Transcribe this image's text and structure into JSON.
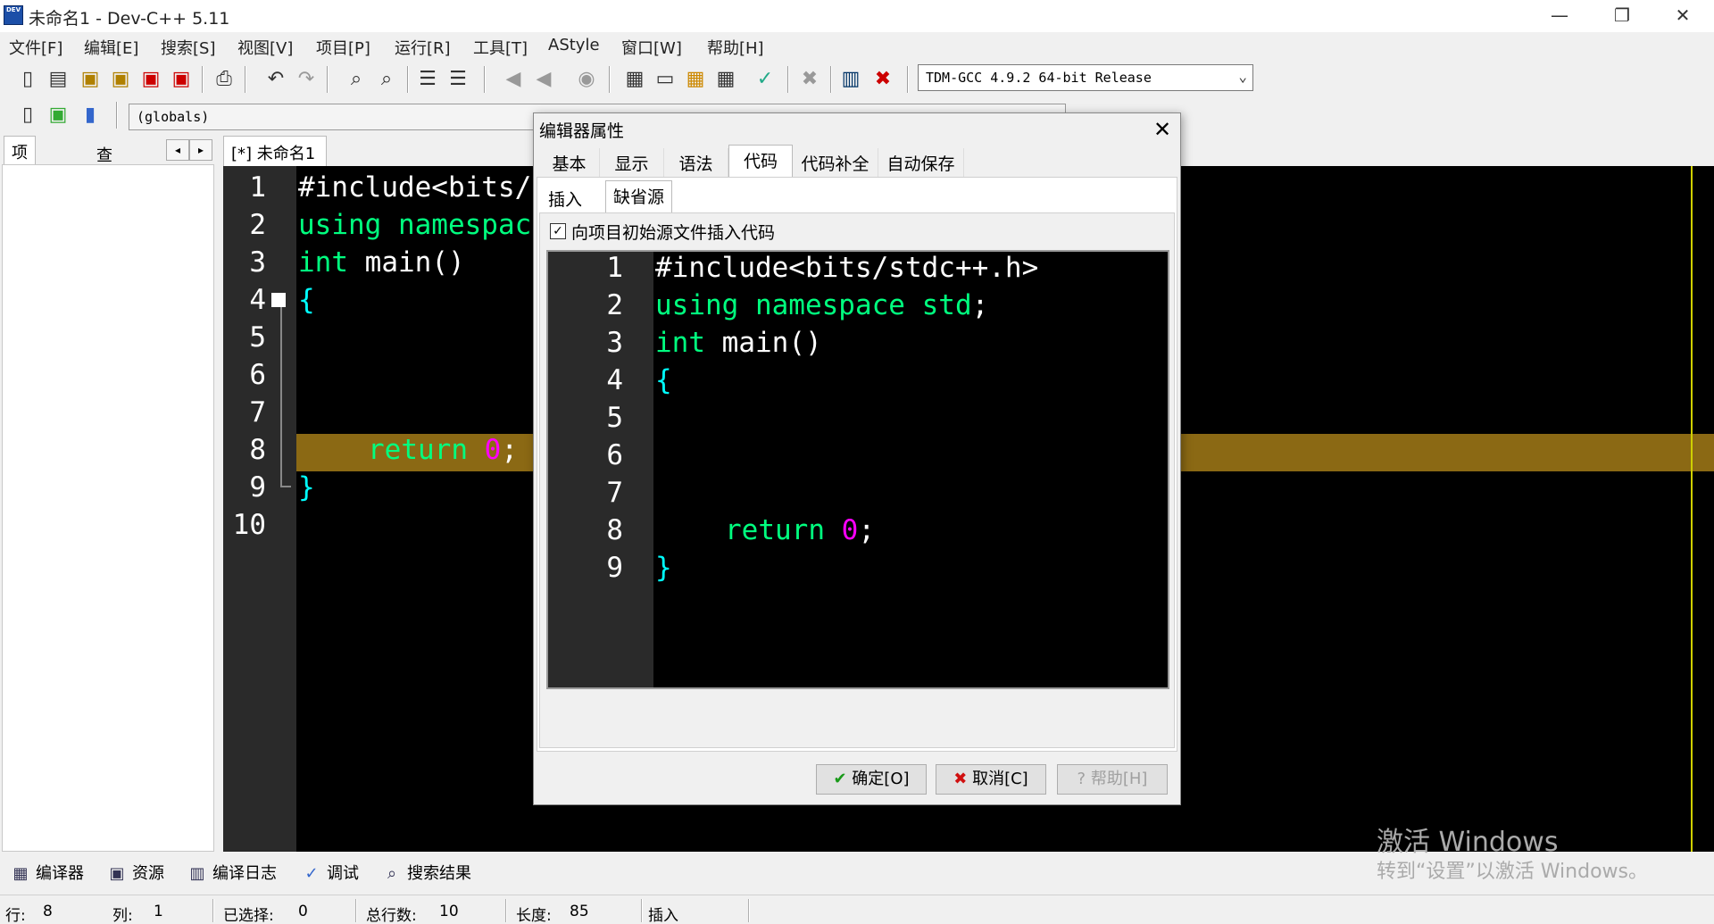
{
  "window": {
    "title": "未命名1 - Dev-C++ 5.11",
    "app_icon_text": "DEV",
    "minimize": "—",
    "restore": "❐",
    "close": "✕"
  },
  "menu": [
    "文件[F]",
    "编辑[E]",
    "搜索[S]",
    "视图[V]",
    "项目[P]",
    "运行[R]",
    "工具[T]",
    "AStyle",
    "窗口[W]",
    "帮助[H]"
  ],
  "toolbar": {
    "compiler": "TDM-GCC 4.9.2 64-bit Release",
    "scope": "(globals)"
  },
  "left_panel": {
    "tabs": [
      "项目管理",
      "查看类"
    ],
    "nav_left": "◂",
    "nav_right": "▸"
  },
  "editor": {
    "tab_label": "[*] 未命名1",
    "line_numbers": [
      "1",
      "2",
      "3",
      "4",
      "5",
      "6",
      "7",
      "8",
      "9",
      "10"
    ],
    "code": {
      "l1": "#include<bits/",
      "l2": "using namespac",
      "l3_kw": "int",
      "l3_rest": " main()",
      "l4": "{",
      "l8_kw": "return",
      "l8_num": "0",
      "l8_end": ";",
      "l9": "}"
    }
  },
  "bottom_tabs": [
    "编译器",
    "资源",
    "编译日志",
    "调试",
    "搜索结果"
  ],
  "status": {
    "row_label": "行:",
    "row": "8",
    "col_label": "列:",
    "col": "1",
    "sel_label": "已选择:",
    "sel": "0",
    "lines_label": "总行数:",
    "lines": "10",
    "len_label": "长度:",
    "len": "85",
    "mode": "插入"
  },
  "watermark": {
    "line1": "激活 Windows",
    "line2": "转到“设置”以激活 Windows。"
  },
  "dialog": {
    "title": "编辑器属性",
    "close": "✕",
    "tabs": [
      "基本",
      "显示",
      "语法",
      "代码",
      "代码补全",
      "自动保存"
    ],
    "active_tab": "代码",
    "subtabs": [
      "插入",
      "缺省源"
    ],
    "active_subtab": "缺省源",
    "checkbox_label": "向项目初始源文件插入代码",
    "checkbox_mark": "✓",
    "line_numbers": [
      "1",
      "2",
      "3",
      "4",
      "5",
      "6",
      "7",
      "8",
      "9"
    ],
    "code": {
      "l1": "#include<bits/stdc++.h>",
      "l2a": "using namespace std",
      "l2b": ";",
      "l3_kw": "int",
      "l3_rest": " main()",
      "l4": "{",
      "l8_kw": "return",
      "l8_num": "0",
      "l8_end": ";",
      "l9": "}"
    },
    "buttons": {
      "ok": "确定[O]",
      "cancel": "取消[C]",
      "help": "帮助[H]"
    }
  }
}
